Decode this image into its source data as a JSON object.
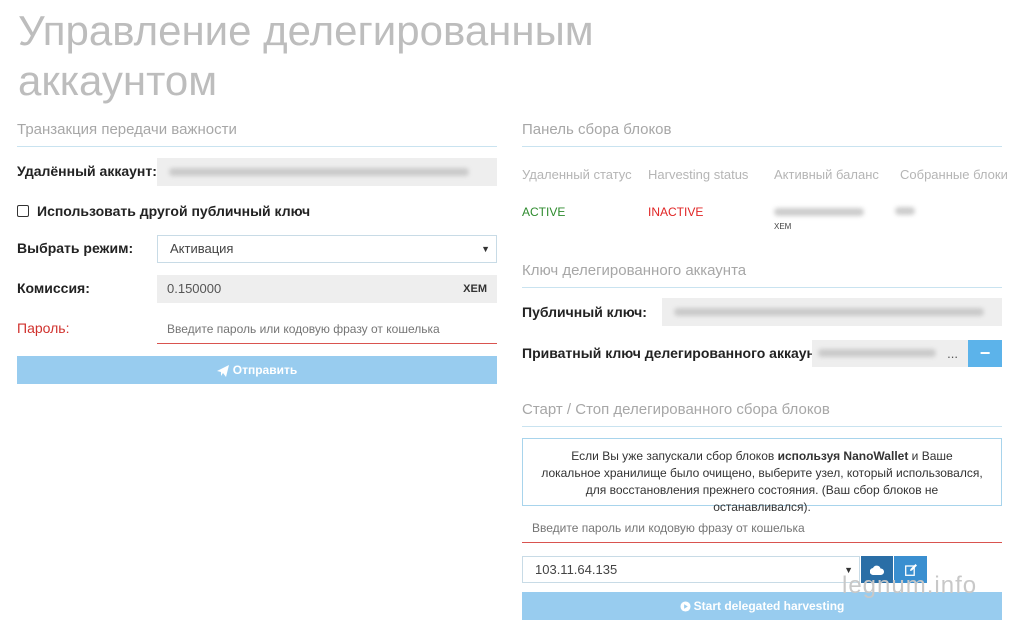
{
  "page": {
    "title": "Управление делегированным аккаунтом"
  },
  "transfer": {
    "section_title": "Транзакция передачи важности",
    "remote_account_label": "Удалённый аккаунт:",
    "use_other_key_label": "Использовать другой публичный ключ",
    "mode_label": "Выбрать режим:",
    "mode_value": "Активация",
    "fee_label": "Комиссия:",
    "fee_value": "0.150000",
    "fee_unit": "XEM",
    "password_label": "Пароль:",
    "password_placeholder": "Введите пароль или кодовую фразу от кошелька",
    "send_label": "Отправить"
  },
  "harvest_panel": {
    "section_title": "Панель сбора блоков",
    "headers": [
      "Удаленный статус",
      "Harvesting status",
      "Активный баланс",
      "Собранные блоки"
    ],
    "remote_status": "ACTIVE",
    "harvesting_status": "INACTIVE",
    "balance_unit": "XEM"
  },
  "delegated_key": {
    "section_title": "Ключ делегированного аккаунта",
    "public_key_label": "Публичный ключ:",
    "private_key_label": "Приватный ключ делегированного аккаунта",
    "ellipsis": "...",
    "toggle_label": "−"
  },
  "start_stop": {
    "section_title": "Старт / Стоп делегированного сбора блоков",
    "info_pre": "Если Вы уже запускали сбор блоков ",
    "info_bold": "используя NanoWallet",
    "info_post": " и Ваше локальное хранилище было очищено, выберите узел, который использовался, для восстановления прежнего состояния. (Ваш сбор блоков не останавливался).",
    "password_placeholder": "Введите пароль или кодовую фразу от кошелька",
    "node_value": "103.11.64.135",
    "start_label": "Start delegated harvesting"
  },
  "watermark": "legnum.info",
  "colors": {
    "accent": "#98ccef",
    "active": "#2e8b2e",
    "inactive": "#e02424",
    "error": "#d0312d"
  }
}
